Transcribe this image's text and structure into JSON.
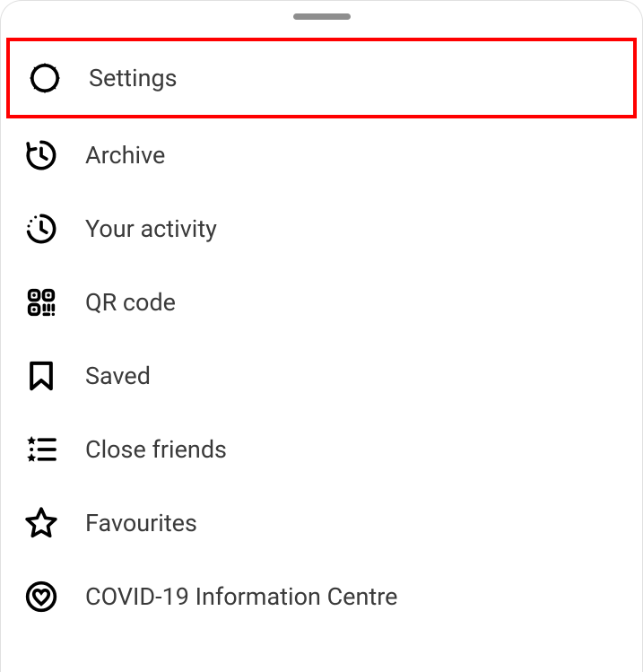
{
  "menu": {
    "items": [
      {
        "label": "Settings"
      },
      {
        "label": "Archive"
      },
      {
        "label": "Your activity"
      },
      {
        "label": "QR code"
      },
      {
        "label": "Saved"
      },
      {
        "label": "Close friends"
      },
      {
        "label": "Favourites"
      },
      {
        "label": "COVID-19 Information Centre"
      }
    ]
  }
}
